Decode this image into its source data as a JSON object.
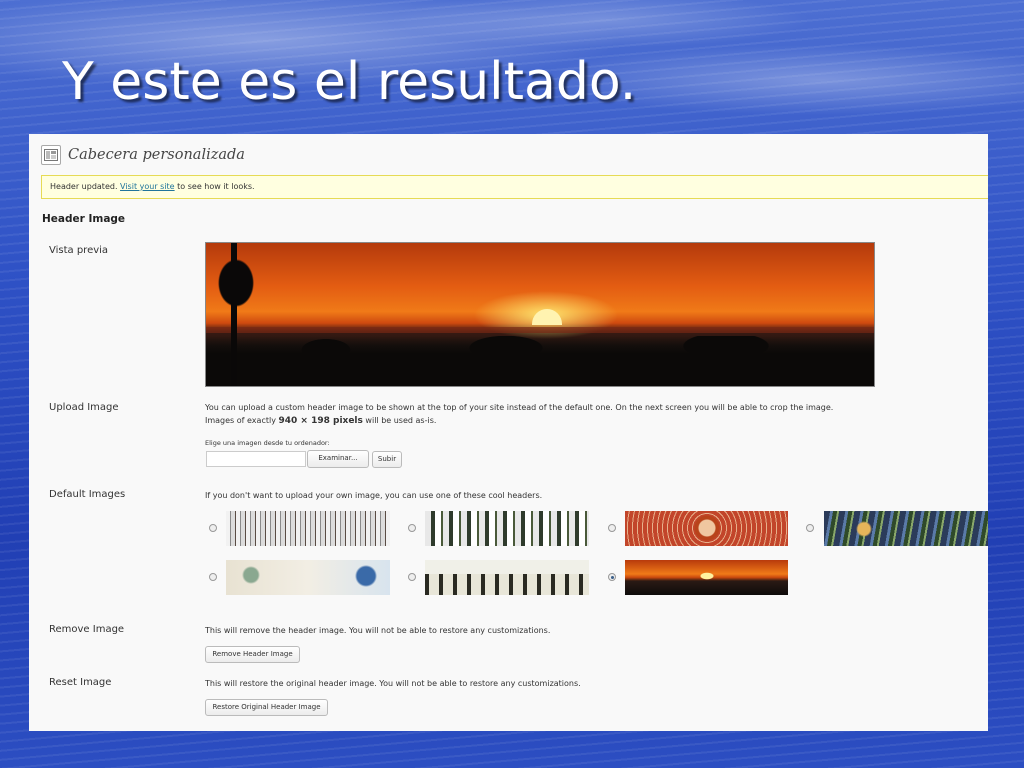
{
  "slide": {
    "title": "Y este es el resultado."
  },
  "page": {
    "heading": "Cabecera personalizada",
    "notice": {
      "prefix": "Header updated. ",
      "link": "Visit your site",
      "suffix": " to see how it looks."
    },
    "section_title": "Header Image",
    "preview": {
      "label": "Vista previa",
      "image": "sunset-header"
    },
    "upload": {
      "label": "Upload Image",
      "desc_line1": "You can upload a custom header image to be shown at the top of your site instead of the default one. On the next screen you will be able to crop the image.",
      "desc_line2_prefix": "Images of exactly ",
      "desc_line2_bold": "940 × 198 pixels",
      "desc_line2_suffix": " will be used as-is.",
      "file_label": "Elige una imagen desde tu ordenador:",
      "file_value": "",
      "browse_button": "Examinar...",
      "submit_button": "Subir"
    },
    "defaults": {
      "label": "Default Images",
      "desc": "If you don't want to upload your own image, you can use one of these cool headers.",
      "options": [
        {
          "name": "winter-forest",
          "selected": false
        },
        {
          "name": "white-blossoms",
          "selected": false
        },
        {
          "name": "red-lace",
          "selected": false
        },
        {
          "name": "fern-shore",
          "selected": false
        },
        {
          "name": "inkwell",
          "selected": false
        },
        {
          "name": "tree-path",
          "selected": false
        },
        {
          "name": "sunset",
          "selected": true
        }
      ]
    },
    "remove": {
      "label": "Remove Image",
      "desc": "This will remove the header image. You will not be able to restore any customizations.",
      "button": "Remove Header Image"
    },
    "reset": {
      "label": "Reset Image",
      "desc": "This will restore the original header image. You will not be able to restore any customizations.",
      "button": "Restore Original Header Image"
    }
  }
}
